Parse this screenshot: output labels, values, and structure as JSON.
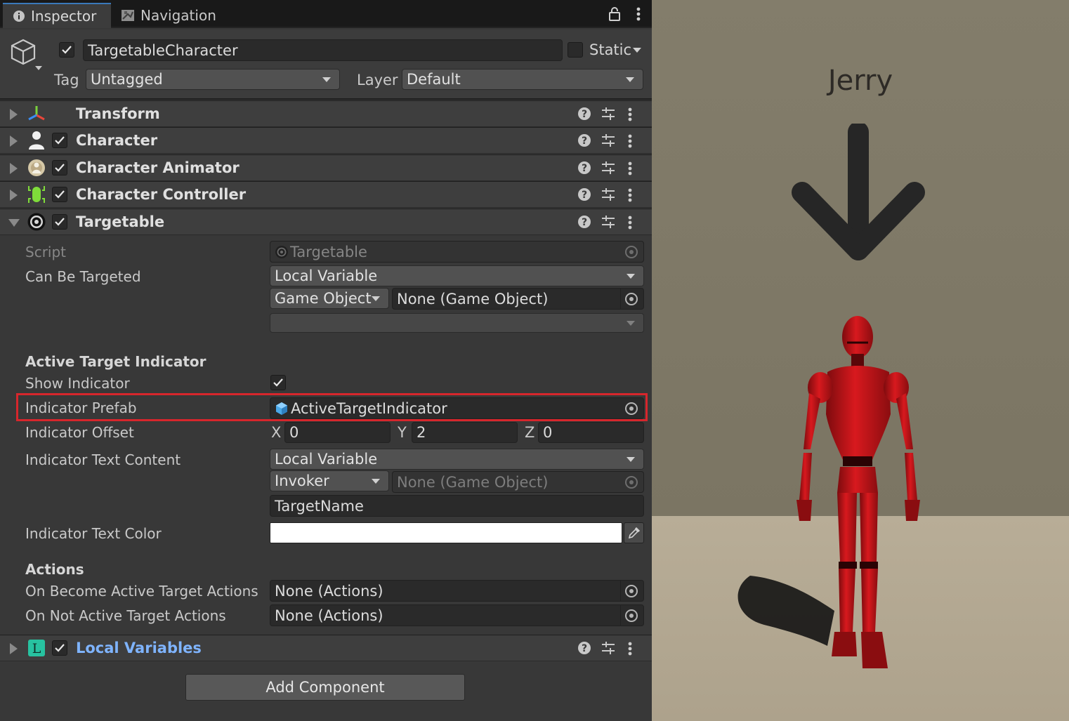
{
  "tabs": {
    "inspector": "Inspector",
    "navigation": "Navigation"
  },
  "object": {
    "active": true,
    "name": "TargetableCharacter",
    "static_label": "Static",
    "static_checked": false,
    "tag_label": "Tag",
    "tag_value": "Untagged",
    "layer_label": "Layer",
    "layer_value": "Default"
  },
  "components": [
    {
      "name": "Transform",
      "icon": "transform-icon",
      "has_checkbox": false,
      "expanded": false
    },
    {
      "name": "Character",
      "icon": "character-icon",
      "has_checkbox": true,
      "expanded": false
    },
    {
      "name": "Character Animator",
      "icon": "animator-icon",
      "has_checkbox": true,
      "expanded": false
    },
    {
      "name": "Character Controller",
      "icon": "controller-icon",
      "has_checkbox": true,
      "expanded": false
    },
    {
      "name": "Targetable",
      "icon": "target-icon",
      "has_checkbox": true,
      "expanded": true
    },
    {
      "name": "Local Variables",
      "icon": "local-variables-icon",
      "has_checkbox": true,
      "expanded": false
    }
  ],
  "targetable": {
    "script_label": "Script",
    "script_value": "Targetable",
    "can_be_targeted_label": "Can Be Targeted",
    "can_be_targeted_source": "Local Variable",
    "can_be_targeted_target": "Game Object",
    "can_be_targeted_object": "None (Game Object)",
    "section_indicator": "Active Target Indicator",
    "show_indicator_label": "Show Indicator",
    "show_indicator": true,
    "indicator_prefab_label": "Indicator Prefab",
    "indicator_prefab_value": "ActiveTargetIndicator",
    "indicator_offset_label": "Indicator Offset",
    "offset": {
      "x_label": "X",
      "x": "0",
      "y_label": "Y",
      "y": "2",
      "z_label": "Z",
      "z": "0"
    },
    "text_content_label": "Indicator Text Content",
    "text_content_source": "Local Variable",
    "text_content_target": "Invoker",
    "text_content_object": "None (Game Object)",
    "text_content_variable": "TargetName",
    "text_color_label": "Indicator Text Color",
    "text_color": "#ffffff",
    "section_actions": "Actions",
    "on_become_label": "On Become Active Target Actions",
    "on_become_value": "None (Actions)",
    "on_not_label": "On Not Active Target Actions",
    "on_not_value": "None (Actions)"
  },
  "add_component": "Add Component",
  "scene": {
    "character_name": "Jerry",
    "wall_color": "#807a68",
    "floor_color": "#b2a791",
    "character_color": "#c8161b",
    "arrow_color": "#262626"
  },
  "colors": {
    "highlight": "#d7262c",
    "accent_tab": "#3a79bb",
    "link": "#7fb4ff"
  }
}
